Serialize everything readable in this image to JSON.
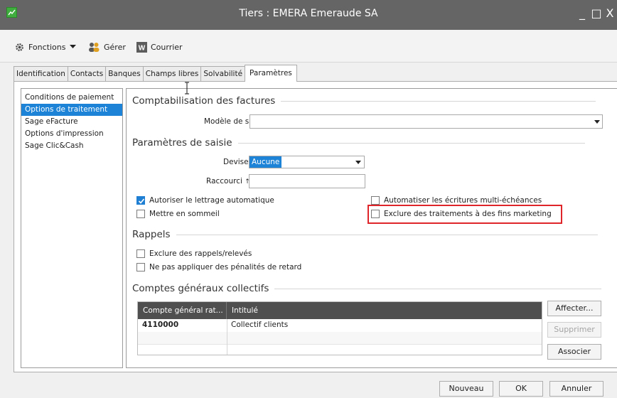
{
  "window": {
    "title": "Tiers : EMERA Emeraude SA",
    "minimize": "_",
    "maximize": "□",
    "close": "X"
  },
  "toolbar": {
    "functions_label": "Fonctions",
    "manage_label": "Gérer",
    "mail_label": "Courrier"
  },
  "tabs": [
    {
      "label": "Identification"
    },
    {
      "label": "Contacts"
    },
    {
      "label": "Banques"
    },
    {
      "label": "Champs libres"
    },
    {
      "label": "Solvabilité"
    },
    {
      "label": "Paramètres",
      "active": true
    }
  ],
  "sidebar": {
    "items": [
      {
        "label": "Conditions de paiement"
      },
      {
        "label": "Options de traitement",
        "selected": true
      },
      {
        "label": "Sage eFacture"
      },
      {
        "label": "Options d'impression"
      },
      {
        "label": "Sage Clic&Cash"
      }
    ]
  },
  "invoicing": {
    "heading": "Comptabilisation des factures",
    "model_label": "Modèle de saisie",
    "model_value": ""
  },
  "entry": {
    "heading": "Paramètres de saisie",
    "currency_label": "Devise",
    "currency_value": "Aucune",
    "shortcut_label": "Raccourci",
    "shortcut_arrow": "↑",
    "shortcut_value": "",
    "auto_lettering_label": "Autoriser le lettrage automatique",
    "auto_lettering_checked": true,
    "sleep_label": "Mettre en sommeil",
    "sleep_checked": false,
    "multi_due_label": "Automatiser les écritures multi-échéances",
    "multi_due_checked": false,
    "marketing_label": "Exclure des traitements à des fins marketing",
    "marketing_checked": false
  },
  "reminders": {
    "heading": "Rappels",
    "exclude_label": "Exclure des rappels/relevés",
    "exclude_checked": false,
    "no_penalty_label": "Ne pas appliquer des pénalités de retard",
    "no_penalty_checked": false
  },
  "accounts": {
    "heading": "Comptes généraux collectifs",
    "columns": [
      "Compte général rat...",
      "Intitulé"
    ],
    "rows": [
      {
        "account": "4110000",
        "label": "Collectif clients"
      }
    ],
    "assign_label": "Affecter...",
    "delete_label": "Supprimer",
    "associate_label": "Associer"
  },
  "footer": {
    "new_label": "Nouveau",
    "ok_label": "OK",
    "cancel_label": "Annuler"
  },
  "colors": {
    "titlebar": "#656565",
    "selection": "#1d83d6",
    "highlight": "#e0252a",
    "grid_header": "#4f4f4f"
  }
}
